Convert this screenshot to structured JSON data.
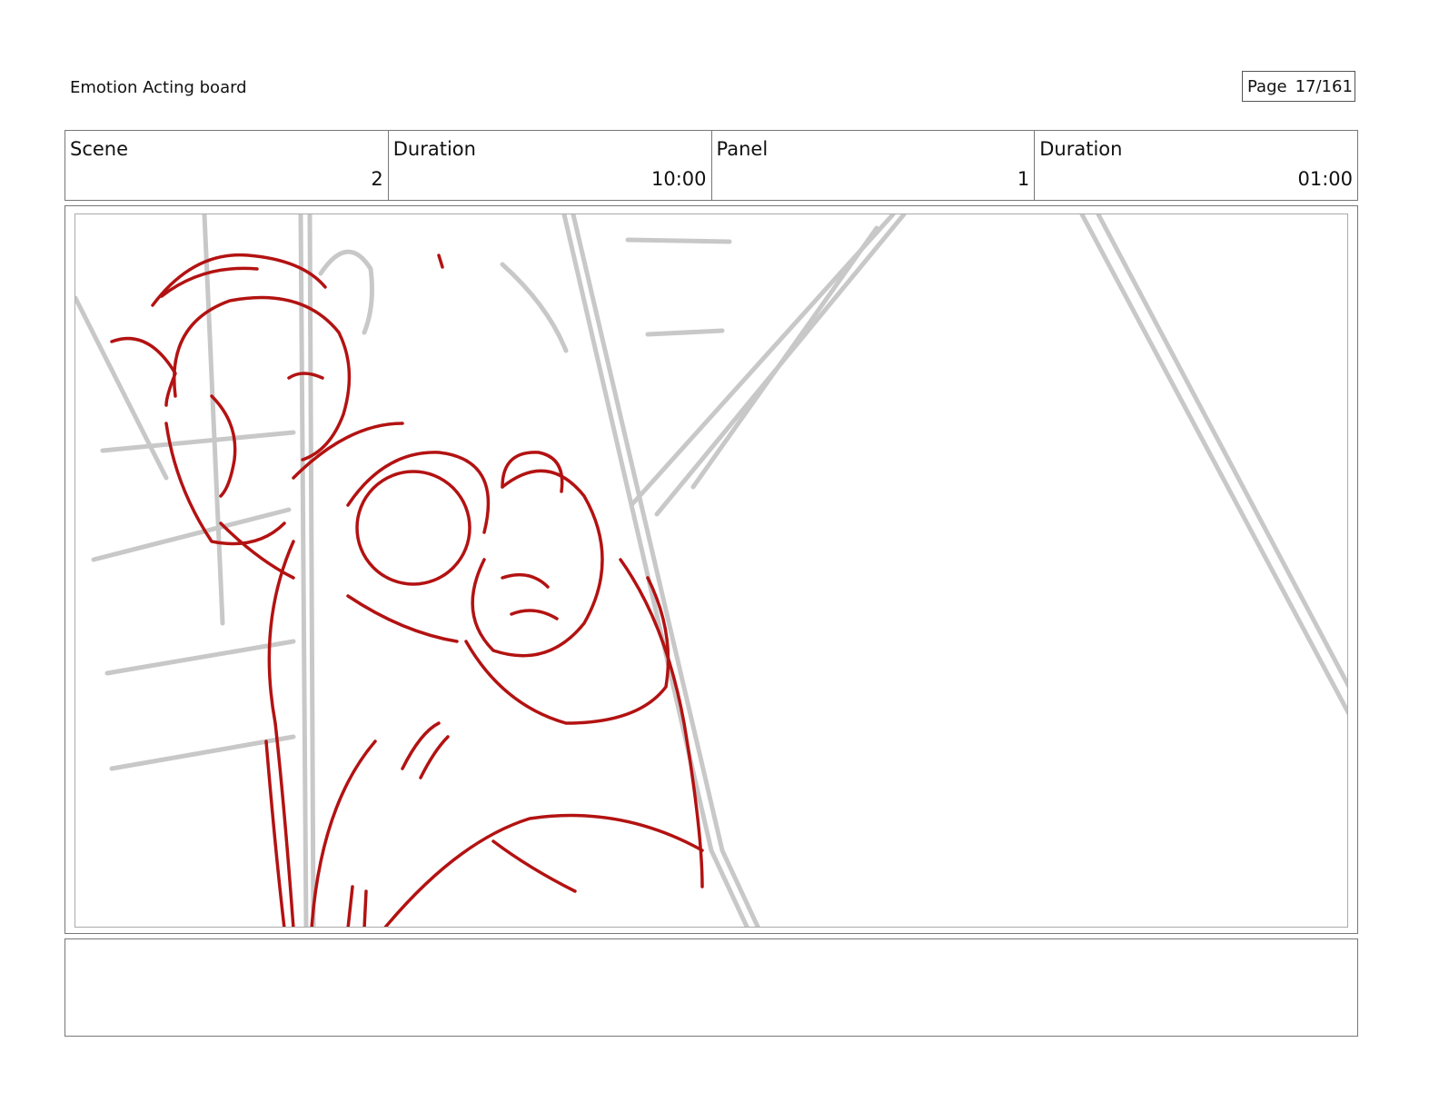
{
  "header": {
    "title": "Emotion Acting board",
    "page_label": "Page",
    "page_value": "17/161"
  },
  "info": [
    {
      "label": "Scene",
      "value": "2"
    },
    {
      "label": "Duration",
      "value": "10:00"
    },
    {
      "label": "Panel",
      "value": "1"
    },
    {
      "label": "Duration",
      "value": "01:00"
    }
  ],
  "panel": {
    "sketch": "rough-character-sketch",
    "colors": {
      "rough": "#b31212",
      "guide": "#c8c8c8"
    }
  },
  "notes": {
    "text": ""
  }
}
